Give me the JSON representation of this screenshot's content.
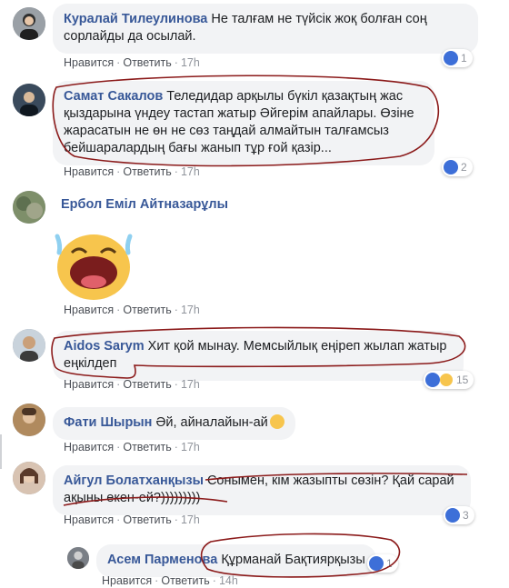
{
  "ui": {
    "like": "Нравится",
    "reply": "Ответить",
    "sep": "·"
  },
  "comments": [
    {
      "name": "Куралай Тилеулинова",
      "text": "Не талғам не түйсік жоқ болған соң сорлайды да осылай.",
      "time": "17h",
      "reactions": "1"
    },
    {
      "name": "Самат Сакалов",
      "text": "Теледидар арқылы бүкіл қазақтың жас қыздарына үндеу тастап жатыр Әйгерім апайлары. Өзіне жарасатын не өн не сөз таңдай алмайтын талғамсыз бейшаралардың бағы жанып тұр ғой қазір...",
      "time": "17h",
      "reactions": "2"
    },
    {
      "name": "Ербол Еміл Айтназарұлы",
      "text": "",
      "time": "17h",
      "reactions": ""
    },
    {
      "name": "Aidos Sarym",
      "text": "Хит қой мынау. Мемсыйлық еңіреп жылап жатыр еңкілдеп",
      "time": "17h",
      "reactions": "15"
    },
    {
      "name": "Фати Шырын",
      "text": "Әй, айналайын-ай",
      "time": "17h",
      "reactions": ""
    },
    {
      "name": "Айгул Болатханқызы",
      "text": "Сонымен, кім жазыпты сөзін? Қай сарай ақыны екен-ей?)))))))))",
      "time": "17h",
      "reactions": "3"
    },
    {
      "name": "Асем Парменова",
      "text": "Құрманай Бақтиярқызы",
      "time": "14h",
      "reactions": "1"
    }
  ],
  "colors": {
    "name": "#385898",
    "bubble": "#f2f3f5",
    "annotation": "#8b1a1a",
    "like_badge": "#3d6fd8"
  },
  "icons": [
    "like-icon",
    "haha-icon",
    "laughing-face-sticker",
    "grinning-emoji"
  ]
}
